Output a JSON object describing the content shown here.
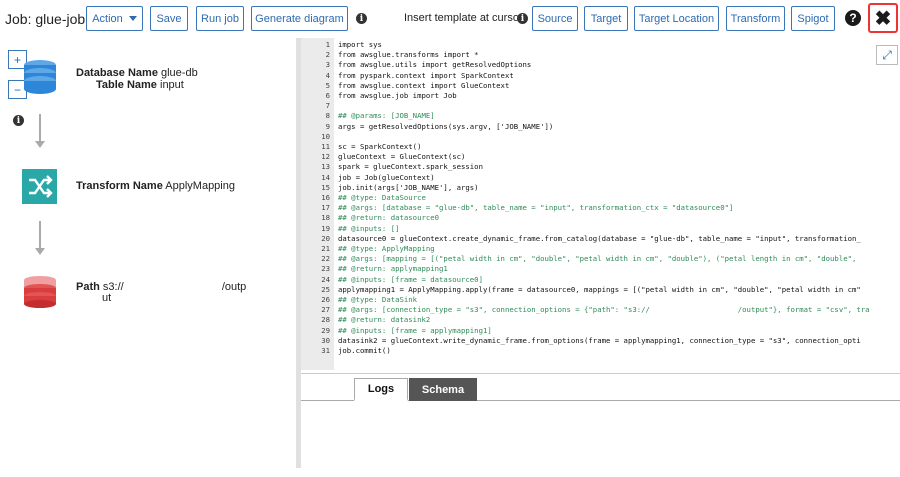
{
  "toolbar": {
    "job_title": "Job: glue-job",
    "action_label": "Action",
    "save_label": "Save",
    "run_job_label": "Run job",
    "generate_diagram_label": "Generate diagram",
    "insert_template_label": "Insert template at cursor",
    "template_buttons": [
      "Source",
      "Target",
      "Target Location",
      "Transform",
      "Spigot"
    ],
    "help_label": "?",
    "close_label": "✖"
  },
  "diagram": {
    "zoom_in_label": "+",
    "zoom_out_label": "−",
    "source_node": {
      "db_key": "Database Name",
      "db_value": "glue-db",
      "table_key": "Table Name",
      "table_value": "input",
      "icon": "database-icon"
    },
    "transform_node": {
      "key": "Transform Name",
      "value": "ApplyMapping",
      "icon": "shuffle-icon"
    },
    "target_node": {
      "key": "Path",
      "value_line1": "s3://",
      "value_suffix": "/outp",
      "value_line2": "ut",
      "icon": "s3-bucket-icon"
    }
  },
  "colors": {
    "accent": "#2e6bb0",
    "database_blue": "#2d86d8",
    "transform_teal": "#2aa8a8",
    "s3_red": "#d93d3d",
    "close_border": "#ee3333"
  },
  "code": {
    "lines": [
      {
        "n": "1",
        "t": "import sys"
      },
      {
        "n": "2",
        "t": "from awsglue.transforms import *"
      },
      {
        "n": "3",
        "t": "from awsglue.utils import getResolvedOptions"
      },
      {
        "n": "4",
        "t": "from pyspark.context import SparkContext"
      },
      {
        "n": "5",
        "t": "from awsglue.context import GlueContext"
      },
      {
        "n": "6",
        "t": "from awsglue.job import Job"
      },
      {
        "n": "7",
        "t": ""
      },
      {
        "n": "8",
        "t": "## @params: [JOB_NAME]"
      },
      {
        "n": "9",
        "t": "args = getResolvedOptions(sys.argv, ['JOB_NAME'])"
      },
      {
        "n": "10",
        "t": ""
      },
      {
        "n": "11",
        "t": "sc = SparkContext()"
      },
      {
        "n": "12",
        "t": "glueContext = GlueContext(sc)"
      },
      {
        "n": "13",
        "t": "spark = glueContext.spark_session"
      },
      {
        "n": "14",
        "t": "job = Job(glueContext)"
      },
      {
        "n": "15",
        "t": "job.init(args['JOB_NAME'], args)"
      },
      {
        "n": "16",
        "t": "## @type: DataSource"
      },
      {
        "n": "17",
        "t": "## @args: [database = \"glue-db\", table_name = \"input\", transformation_ctx = \"datasource0\"]"
      },
      {
        "n": "18",
        "t": "## @return: datasource0"
      },
      {
        "n": "19",
        "t": "## @inputs: []"
      },
      {
        "n": "20",
        "t": "datasource0 = glueContext.create_dynamic_frame.from_catalog(database = \"glue-db\", table_name = \"input\", transformation_"
      },
      {
        "n": "21",
        "t": "## @type: ApplyMapping"
      },
      {
        "n": "22",
        "t": "## @args: [mapping = [(\"petal width in cm\", \"double\", \"petal width in cm\", \"double\"), (\"petal length in cm\", \"double\","
      },
      {
        "n": "23",
        "t": "## @return: applymapping1"
      },
      {
        "n": "24",
        "t": "## @inputs: [frame = datasource0]"
      },
      {
        "n": "25",
        "t": "applymapping1 = ApplyMapping.apply(frame = datasource0, mappings = [(\"petal width in cm\", \"double\", \"petal width in cm\""
      },
      {
        "n": "26",
        "t": "## @type: DataSink"
      },
      {
        "n": "27",
        "t": "## @args: [connection_type = \"s3\", connection_options = {\"path\": \"s3://                    /output\"}, format = \"csv\", tra"
      },
      {
        "n": "28",
        "t": "## @return: datasink2"
      },
      {
        "n": "29",
        "t": "## @inputs: [frame = applymapping1]"
      },
      {
        "n": "30",
        "t": "datasink2 = glueContext.write_dynamic_frame.from_options(frame = applymapping1, connection_type = \"s3\", connection_opti"
      },
      {
        "n": "31",
        "t": "job.commit()"
      }
    ]
  },
  "bottom_tabs": {
    "logs": "Logs",
    "schema": "Schema"
  }
}
